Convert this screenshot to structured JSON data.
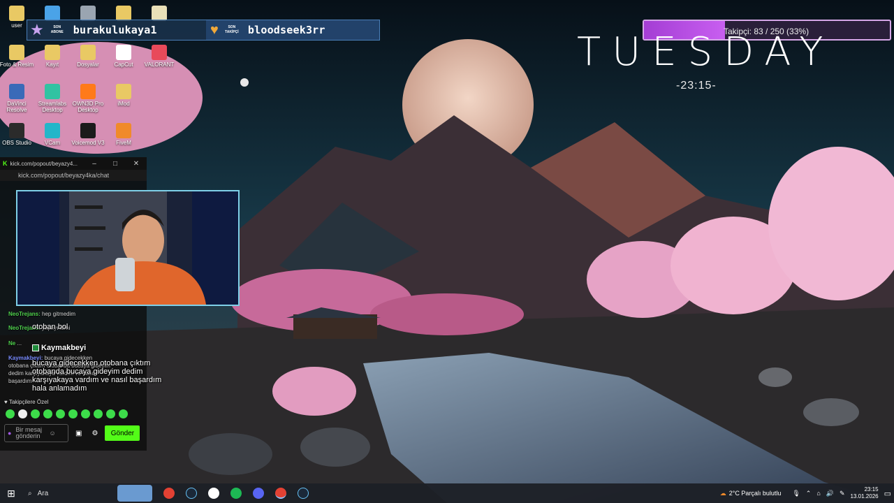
{
  "desktop": {
    "icons": [
      {
        "label": "user",
        "color": "#e9c964"
      },
      {
        "label": "",
        "color": "#4aa3e8"
      },
      {
        "label": "",
        "color": "#9aa5b1"
      },
      {
        "label": "",
        "color": "#e9c964"
      },
      {
        "label": "",
        "color": "#e9e0b8"
      },
      {
        "label": "Foto & Resim",
        "color": "#e9c964"
      },
      {
        "label": "Kayıt",
        "color": "#e9c964"
      },
      {
        "label": "Dosyalar",
        "color": "#e9c964"
      },
      {
        "label": "CapCut",
        "color": "#ffffff"
      },
      {
        "label": "VALORANT",
        "color": "#e84a5a"
      },
      {
        "label": "DaVinci Resolve",
        "color": "#3a6ab8"
      },
      {
        "label": "Streamlabs Desktop",
        "color": "#31c3a2"
      },
      {
        "label": "OWN3D Pro Desktop",
        "color": "#ff7a1a"
      },
      {
        "label": "iMod",
        "color": "#e9c964"
      },
      {
        "label": "OBS Studio",
        "color": "#2b2b2b"
      },
      {
        "label": "VCam",
        "color": "#23b6c9"
      },
      {
        "label": "Voicemod V3",
        "color": "#1b1b1b"
      },
      {
        "label": "FiveM",
        "color": "#f08a2a"
      }
    ]
  },
  "stream_bar": {
    "last_sub_label": "SON ABONE",
    "last_sub_name": "burakulukaya1",
    "last_follow_label": "SON TAKİPÇİ",
    "last_follow_name": "bloodseek3rr"
  },
  "follower_goal": {
    "text": "Takipçi: 83 / 250 (33%)",
    "current": 83,
    "target": 250,
    "percent": 33
  },
  "day_name": "TUESDAY",
  "clock_text": "-23:15-",
  "kick_window": {
    "title": "kick.com/popout/beyazy4...",
    "address": "kick.com/popout/beyazy4ka/chat",
    "chat": [
      {
        "nick": "NeoTrejans:",
        "text": "hep gitmedim"
      },
      {
        "nick": "NeoTrejans:",
        "text": "yaptıyı dimi"
      },
      {
        "nick": "Ne",
        "text": "..."
      },
      {
        "nick": "Kaymakbeyi:",
        "text": "bucaya gidecekken otobana çıktım otobanda bucaya gideyim dedim karşıyakaya vardım ve nasıl başardım"
      }
    ],
    "followers_only": "Takipçilere Özel",
    "message_placeholder": "Bir mesaj gönderin",
    "send_label": "Gönder"
  },
  "overlay": {
    "short_msg": "otoban bol",
    "highlight_user": "Kaymakbeyi",
    "highlight_lines": [
      "bucaya gidecekken otobana çıktım",
      "otobanda bucaya gideyim dedim",
      "karşıyakaya vardım ve nasıl başardım",
      "hala anlamadım"
    ]
  },
  "taskbar": {
    "search_placeholder": "Ara",
    "weather": "2°C  Parçalı bulutlu",
    "time": "23:15",
    "date": "13.01.2026"
  }
}
